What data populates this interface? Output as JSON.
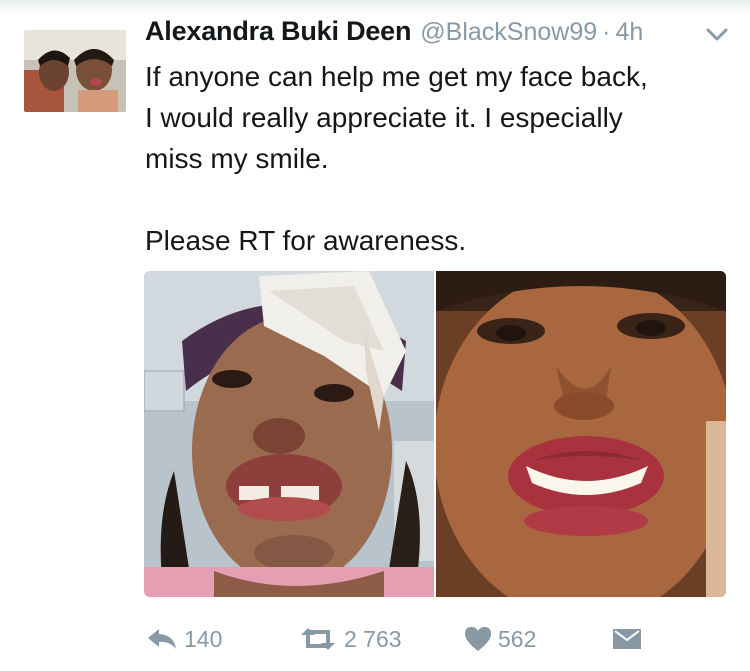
{
  "tweet": {
    "author": {
      "display_name": "Alexandra Buki Deen",
      "handle": "@BlackSnow99",
      "separator": "·",
      "time": "4h"
    },
    "text_lines": [
      "If anyone can help me get my face back,",
      "I would really appreciate it. I especially",
      "miss my smile."
    ],
    "text_line_2": "Please RT for awareness.",
    "media": {
      "left_photo": "before-photo",
      "right_photo": "after-photo"
    },
    "actions": {
      "replies": "140",
      "retweets": "2 763",
      "likes": "562"
    }
  },
  "icons": {
    "caret": "chevron-down-icon",
    "reply": "reply-icon",
    "retweet": "retweet-icon",
    "like": "heart-icon",
    "dm": "envelope-icon"
  },
  "colors": {
    "text": "#14171a",
    "muted": "#8899a6"
  }
}
